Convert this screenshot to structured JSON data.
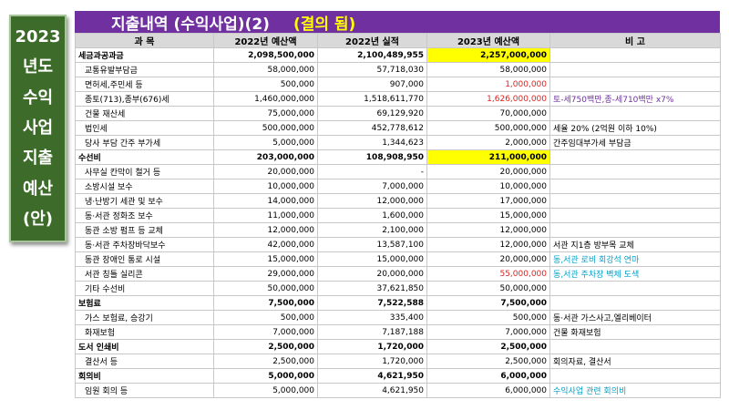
{
  "side_title": [
    "2023",
    "년도",
    "수익",
    "사업",
    "지출",
    "예산",
    "(안)"
  ],
  "header": {
    "title": "지출내역 (수익사업)(2)",
    "status": "(결의 됨)"
  },
  "columns": [
    "과  목",
    "2022년 예산액",
    "2022년 실적",
    "2023년 예산액",
    "비          고"
  ],
  "rows": [
    {
      "kind": "main",
      "name": "세금과공과금",
      "b2022": "2,098,500,000",
      "a2022": "2,100,489,955",
      "b2023": "2,257,000,000",
      "hl": "yellow",
      "note": "",
      "note_style": ""
    },
    {
      "kind": "sub",
      "name": "교통유발부담금",
      "b2022": "58,000,000",
      "a2022": "57,718,030",
      "b2023": "58,000,000",
      "hl": "",
      "note": "",
      "note_style": ""
    },
    {
      "kind": "sub",
      "name": "면허세,주민세 등",
      "b2022": "500,000",
      "a2022": "907,000",
      "b2023": "1,000,000",
      "hl": "red",
      "note": "",
      "note_style": ""
    },
    {
      "kind": "sub",
      "name": "종토(713),종부(676)세",
      "b2022": "1,460,000,000",
      "a2022": "1,518,611,770",
      "b2023": "1,626,000,000",
      "hl": "red",
      "note": "토-세750백만,종-세710백만  x7%",
      "note_style": "purple"
    },
    {
      "kind": "sub",
      "name": "건물 재산세",
      "b2022": "75,000,000",
      "a2022": "69,129,920",
      "b2023": "70,000,000",
      "hl": "",
      "note": "",
      "note_style": ""
    },
    {
      "kind": "sub",
      "name": "법인세",
      "b2022": "500,000,000",
      "a2022": "452,778,612",
      "b2023": "500,000,000",
      "hl": "",
      "note": "세율 20% (2억원 이하 10%)",
      "note_style": "black"
    },
    {
      "kind": "sub",
      "name": "당사 부담 간주 부가세",
      "b2022": "5,000,000",
      "a2022": "1,344,623",
      "b2023": "2,000,000",
      "hl": "",
      "note": "간주임대부가세  부담금",
      "note_style": "black"
    },
    {
      "kind": "main",
      "name": "수선비",
      "b2022": "203,000,000",
      "a2022": "108,908,950",
      "b2023": "211,000,000",
      "hl": "yellow",
      "note": "",
      "note_style": ""
    },
    {
      "kind": "sub",
      "name": "사무실 칸막이 철거 등",
      "b2022": "20,000,000",
      "a2022": "-",
      "b2023": "20,000,000",
      "hl": "",
      "note": "",
      "note_style": ""
    },
    {
      "kind": "sub",
      "name": "소방시설 보수",
      "b2022": "10,000,000",
      "a2022": "7,000,000",
      "b2023": "10,000,000",
      "hl": "",
      "note": "",
      "note_style": ""
    },
    {
      "kind": "sub",
      "name": "냉·난방기 세관 및 보수",
      "b2022": "14,000,000",
      "a2022": "12,000,000",
      "b2023": "17,000,000",
      "hl": "",
      "note": "",
      "note_style": ""
    },
    {
      "kind": "sub",
      "name": "동·서관 정화조 보수",
      "b2022": "11,000,000",
      "a2022": "1,600,000",
      "b2023": "15,000,000",
      "hl": "",
      "note": "",
      "note_style": ""
    },
    {
      "kind": "sub",
      "name": "동관 소방 펌프 등 교체",
      "b2022": "12,000,000",
      "a2022": "2,100,000",
      "b2023": "12,000,000",
      "hl": "",
      "note": "",
      "note_style": ""
    },
    {
      "kind": "sub",
      "name": "동·서관 주차장바닥보수",
      "b2022": "42,000,000",
      "a2022": "13,587,100",
      "b2023": "12,000,000",
      "hl": "",
      "note": "서관 지1층 방부목 교체",
      "note_style": "black"
    },
    {
      "kind": "sub",
      "name": "동관 장애인 통로 시설",
      "b2022": "15,000,000",
      "a2022": "15,000,000",
      "b2023": "20,000,000",
      "hl": "",
      "note": "동,서관 로비 회강석 연마",
      "note_style": "cyan"
    },
    {
      "kind": "sub",
      "name": "서관 칭틀 실리콘",
      "b2022": "29,000,000",
      "a2022": "20,000,000",
      "b2023": "55,000,000",
      "hl": "red",
      "note": "동,서관 주차장 벽체 도색",
      "note_style": "cyan"
    },
    {
      "kind": "sub",
      "name": "기타 수선비",
      "b2022": "50,000,000",
      "a2022": "37,621,850",
      "b2023": "50,000,000",
      "hl": "",
      "note": "",
      "note_style": ""
    },
    {
      "kind": "main",
      "name": "보험료",
      "b2022": "7,500,000",
      "a2022": "7,522,588",
      "b2023": "7,500,000",
      "hl": "",
      "note": "",
      "note_style": ""
    },
    {
      "kind": "sub",
      "name": "가스 보험료, 승강기",
      "b2022": "500,000",
      "a2022": "335,400",
      "b2023": "500,000",
      "hl": "",
      "note": "동·서관 가스사고,엘리베이터",
      "note_style": "black"
    },
    {
      "kind": "sub",
      "name": "화재보험",
      "b2022": "7,000,000",
      "a2022": "7,187,188",
      "b2023": "7,000,000",
      "hl": "",
      "note": "건물 화재보험",
      "note_style": "black"
    },
    {
      "kind": "main",
      "name": "도서 인쇄비",
      "b2022": "2,500,000",
      "a2022": "1,720,000",
      "b2023": "2,500,000",
      "hl": "",
      "note": "",
      "note_style": ""
    },
    {
      "kind": "sub",
      "name": "결산서 등",
      "b2022": "2,500,000",
      "a2022": "1,720,000",
      "b2023": "2,500,000",
      "hl": "",
      "note": "회의자료, 결산서",
      "note_style": "black"
    },
    {
      "kind": "main",
      "name": "회의비",
      "b2022": "5,000,000",
      "a2022": "4,621,950",
      "b2023": "6,000,000",
      "hl": "",
      "note": "",
      "note_style": ""
    },
    {
      "kind": "sub",
      "name": "임원 회의 등",
      "b2022": "5,000,000",
      "a2022": "4,621,950",
      "b2023": "6,000,000",
      "hl": "",
      "note": "수익사업 관련 회의비",
      "note_style": "cyan"
    }
  ]
}
